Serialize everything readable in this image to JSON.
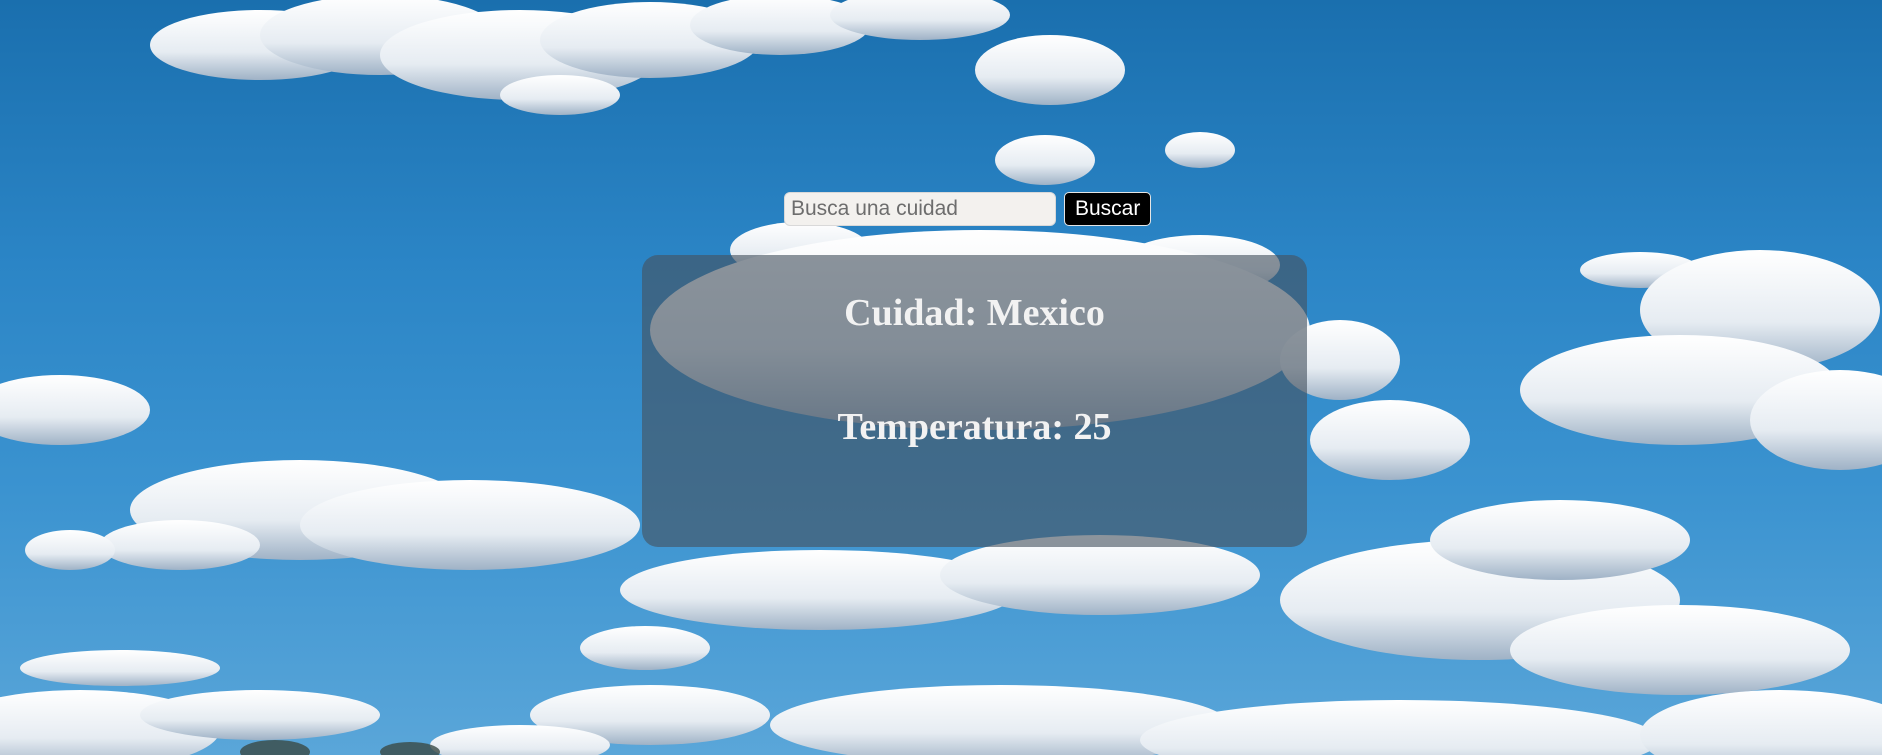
{
  "search": {
    "placeholder": "Busca una cuidad",
    "value": "",
    "button_label": "Buscar"
  },
  "weather": {
    "city_label": "Cuidad: Mexico",
    "temperature_label": "Temperatura: 25"
  },
  "colors": {
    "sky_top": "#1a6fae",
    "sky_bottom": "#5aa6d9",
    "card_overlay": "rgba(70,82,96,0.62)",
    "button_background": "#000000",
    "input_background": "#f3f1ee"
  }
}
